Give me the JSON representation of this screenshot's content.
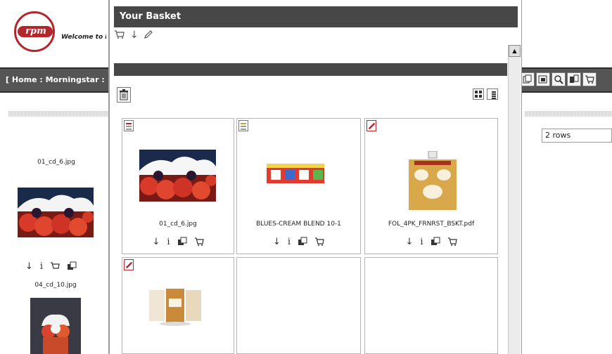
{
  "background": {
    "logo_text": "rpm",
    "welcome_text": "Welcome to R",
    "breadcrumb": "[ Home : Morningstar :",
    "toolbar_icons": [
      "copy-icon",
      "copy2-icon",
      "search-icon",
      "compare-icon",
      "cart-icon"
    ],
    "rows_select": "2 rows",
    "items": [
      {
        "caption": "01_cd_6.jpg"
      },
      {
        "caption": "04_cd_10.jpg"
      }
    ]
  },
  "basket": {
    "title": "Your Basket",
    "header_icons": [
      "cart-icon",
      "download-icon",
      "edit-icon"
    ],
    "tiles": [
      {
        "name": "01_cd_6.jpg",
        "file_type": "image"
      },
      {
        "name": "BLUES-CREAM BLEND 10-1",
        "file_type": "document"
      },
      {
        "name": "FOL_4PK_FRNRST_BSKT.pdf",
        "file_type": "pdf"
      },
      {
        "name": "",
        "file_type": "pdf"
      }
    ],
    "tile_actions": [
      "download-icon",
      "info-icon",
      "copy-icon",
      "cart-icon"
    ]
  },
  "colors": {
    "title_bar": "#474747",
    "logo_red": "#b3262c"
  }
}
